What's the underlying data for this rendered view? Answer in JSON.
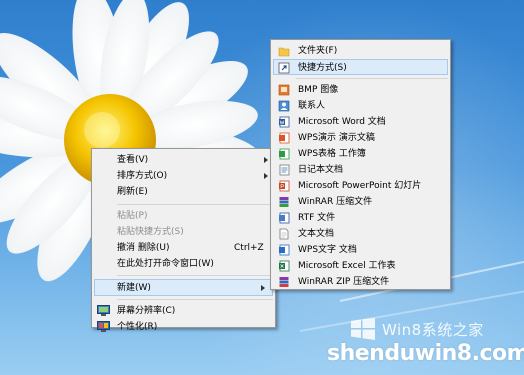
{
  "context_menu": {
    "items": [
      {
        "label": "查看(V)",
        "has_submenu": true,
        "disabled": false
      },
      {
        "label": "排序方式(O)",
        "has_submenu": true,
        "disabled": false
      },
      {
        "label": "刷新(E)",
        "has_submenu": false,
        "disabled": false
      },
      {
        "label": "粘贴(P)",
        "has_submenu": false,
        "disabled": true
      },
      {
        "label": "粘贴快捷方式(S)",
        "has_submenu": false,
        "disabled": true
      },
      {
        "label": "撤消 删除(U)",
        "shortcut": "Ctrl+Z",
        "disabled": false
      },
      {
        "label": "在此处打开命令窗口(W)",
        "disabled": false
      },
      {
        "label": "新建(W)",
        "has_submenu": true,
        "highlighted": true
      },
      {
        "label": "屏幕分辨率(C)",
        "icon": "display-icon"
      },
      {
        "label": "个性化(R)",
        "icon": "personalize-icon"
      }
    ]
  },
  "new_submenu": {
    "items": [
      {
        "label": "文件夹(F)",
        "icon": "folder-icon"
      },
      {
        "label": "快捷方式(S)",
        "icon": "shortcut-icon",
        "highlighted": true
      },
      {
        "label": "BMP 图像",
        "icon": "bmp-image-icon"
      },
      {
        "label": "联系人",
        "icon": "contact-icon"
      },
      {
        "label": "Microsoft Word 文档",
        "icon": "word-doc-icon"
      },
      {
        "label": "WPS演示 演示文稿",
        "icon": "wps-presentation-icon"
      },
      {
        "label": "WPS表格 工作簿",
        "icon": "wps-spreadsheet-icon"
      },
      {
        "label": "日记本文档",
        "icon": "journal-icon"
      },
      {
        "label": "Microsoft PowerPoint 幻灯片",
        "icon": "powerpoint-icon"
      },
      {
        "label": "WinRAR 压缩文件",
        "icon": "winrar-icon"
      },
      {
        "label": "RTF 文件",
        "icon": "rtf-icon"
      },
      {
        "label": "文本文档",
        "icon": "text-doc-icon"
      },
      {
        "label": "WPS文字 文档",
        "icon": "wps-writer-icon"
      },
      {
        "label": "Microsoft Excel 工作表",
        "icon": "excel-icon"
      },
      {
        "label": "WinRAR ZIP 压缩文件",
        "icon": "winrar-zip-icon"
      }
    ]
  },
  "watermark": {
    "brand": "Win8系统之家",
    "site": "shenduwin8.com"
  },
  "colors": {
    "menu_bg": "#f0f0f0",
    "highlight_bg": "#dcebfa",
    "highlight_border": "#a8c9ee",
    "disabled_text": "#8d8d8d"
  }
}
